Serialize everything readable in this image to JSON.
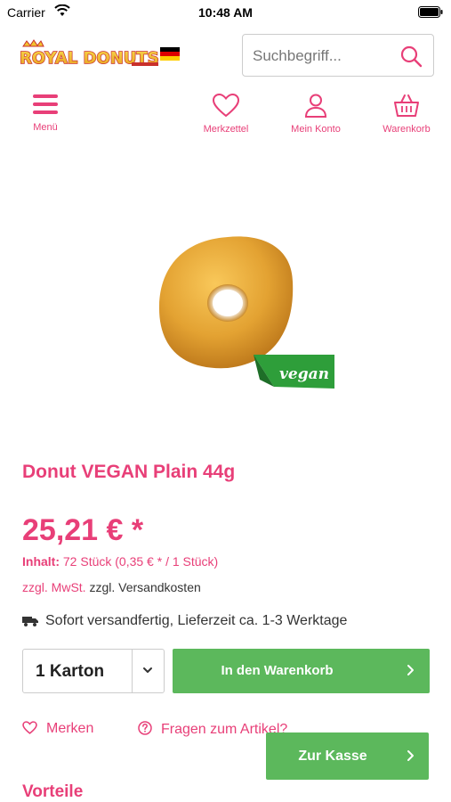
{
  "status_bar": {
    "carrier": "Carrier",
    "time": "10:48 AM"
  },
  "header": {
    "logo_text": "ROYAL DONUTS",
    "search": {
      "placeholder": "Suchbegriff..."
    }
  },
  "nav": {
    "menu": "Menü",
    "wishlist": "Merkzettel",
    "account": "Mein Konto",
    "cart": "Warenkorb"
  },
  "product": {
    "badge": "vegan",
    "title": "Donut VEGAN Plain 44g",
    "price": "25,21 € *",
    "content_label": "Inhalt:",
    "content_value": "72 Stück (0,35 € * / 1 Stück)",
    "tax_link": "zzgl. MwSt.",
    "shipping": "zzgl. Versandkosten",
    "delivery": "Sofort versandfertig, Lieferzeit ca. 1-3 Werktage"
  },
  "buy": {
    "quantity": "1 Karton",
    "add_to_cart": "In den Warenkorb"
  },
  "actions": {
    "wishlist": "Merken",
    "question": "Fragen zum Artikel?"
  },
  "checkout": "Zur Kasse",
  "section_title": "Vorteile",
  "colors": {
    "brand_pink": "#e83f78",
    "button_green": "#5cb85c"
  }
}
